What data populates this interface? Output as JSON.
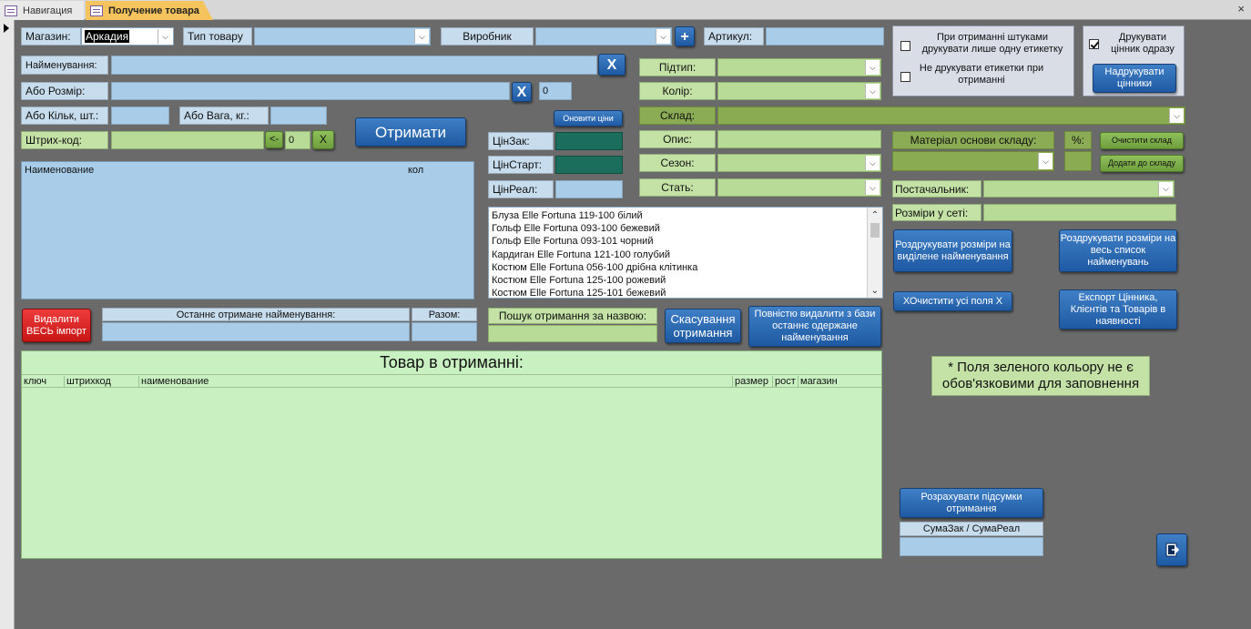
{
  "tabs": {
    "nav": "Навигация",
    "receive": "Получение товара",
    "close": "×"
  },
  "store": {
    "label": "Магазин:",
    "value": "Аркадия"
  },
  "product_type": {
    "label": "Тип товару",
    "value": ""
  },
  "maker": {
    "label": "Виробник",
    "value": ""
  },
  "add_btn": "+",
  "article": {
    "label": "Артикул:",
    "value": ""
  },
  "name": {
    "label": "Найменування:",
    "value": "",
    "clear": "X"
  },
  "size": {
    "label": "Або Розмір:",
    "value": "",
    "clear": "X",
    "count": "0"
  },
  "qty": {
    "label": "Або Кільк, шт.:",
    "value": ""
  },
  "weight": {
    "label": "Або Вага, кг.:",
    "value": ""
  },
  "barcode": {
    "label": "Штрих-код:",
    "back": "<-",
    "value": "0",
    "clear": "X"
  },
  "receive_btn": "Отримати",
  "update_prices_btn": "Оновити ціни",
  "prices": {
    "cost_label": "ЦінЗак:",
    "start_label": "ЦінСтарт:",
    "real_label": "ЦінРеал:"
  },
  "subtype": {
    "label": "Підтип:"
  },
  "color": {
    "label": "Колір:"
  },
  "warehouse": {
    "label": "Склад:"
  },
  "description": {
    "label": "Опис:"
  },
  "season": {
    "label": "Сезон:"
  },
  "gender": {
    "label": "Стать:"
  },
  "print_options": {
    "one_label": "При отриманні штуками друкувати лише одну етикетку",
    "one_checked": false,
    "no_labels": "Не друкувати етикетки при отриманні",
    "no_labels_checked": false,
    "print_now": "Друкувати цінник одразу",
    "print_now_checked": true,
    "print_btn": "Надрукувати цінники"
  },
  "material": {
    "label": "Матеріал основи складу:",
    "percent_label": "%:",
    "clear_btn": "Очистити склад",
    "add_btn": "Додати до складу"
  },
  "supplier": {
    "label": "Постачальник:"
  },
  "sizes_network": {
    "label": "Розміри у сеті:"
  },
  "print_sizes_selected": "Роздрукувати розміри на виділене найменування",
  "print_sizes_all": "Роздрукувати розміри на весь список найменувань",
  "clear_all_x": "ХОчистити усі поля Х",
  "export_btn": "Експорт Цінника, Клієнтів та Товарів в наявності",
  "left_list": {
    "col_name": "Наименование",
    "col_qty": "кол"
  },
  "items": [
    "Блуза Elle Fortuna 119-100 білий",
    "Гольф Elle Fortuna 093-100 бежевий",
    "Гольф Elle Fortuna 093-101 чорний",
    "Кардиган Elle Fortuna 121-100 голубий",
    "Костюм Elle Fortuna 056-100 дрібна клітинка",
    "Костюм Elle Fortuna 125-100 рожевий",
    "Костюм Elle Fortuna 125-101 бежевий"
  ],
  "delete_all_btn": "Видалити ВЕСЬ імпорт",
  "last_received": {
    "label": "Останнє отримане найменування:",
    "total_label": "Разом:"
  },
  "search": {
    "label": "Пошук отримання за назвою:"
  },
  "cancel_btn": "Скасування отримання",
  "delete_last_btn": "Повністю видалити з бази останнє одержане найменування",
  "received_table": {
    "title": "Товар в отриманні:",
    "columns": [
      "ключ",
      "штрихкод",
      "наименование",
      "размер",
      "рост",
      "магазин"
    ]
  },
  "note": "* Поля зеленого кольору не є обов'язковими для заповнення",
  "calc_btn": "Розрахувати підсумки отримання",
  "sums_label": "СумаЗак / СумаРеал"
}
